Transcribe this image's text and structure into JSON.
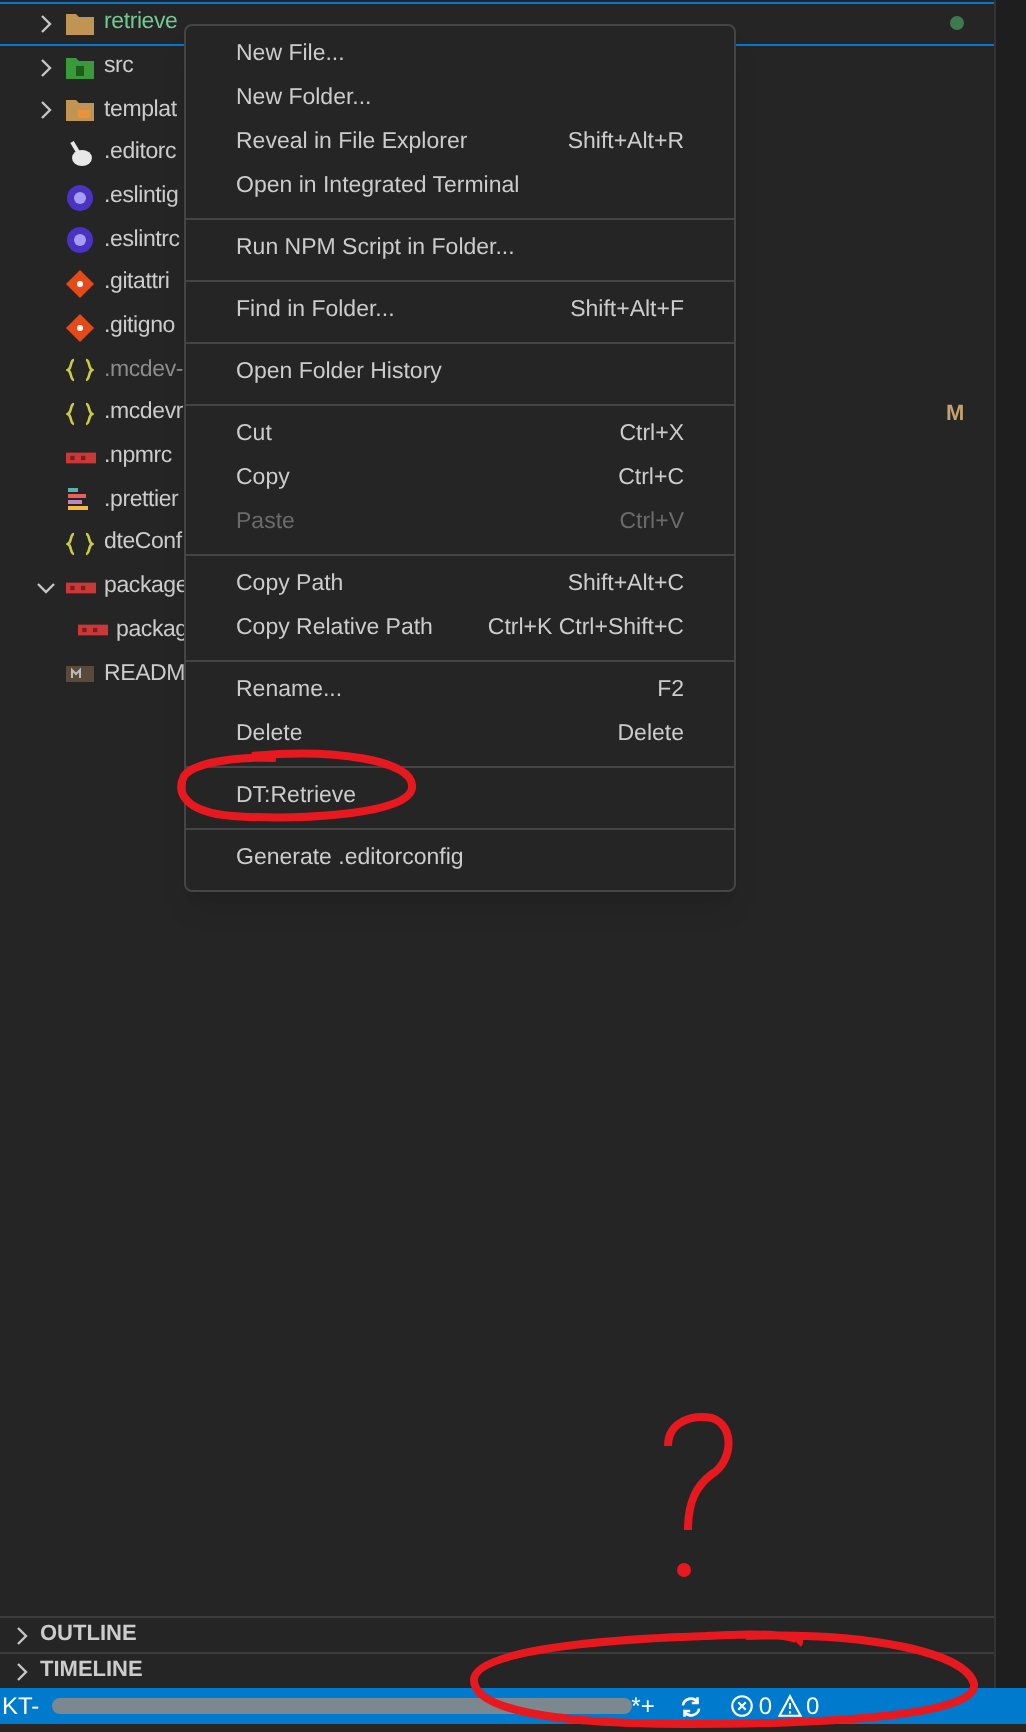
{
  "explorer": {
    "tree": [
      {
        "label": "retrieve",
        "kind": "folder",
        "expanded": false,
        "selected": true,
        "untracked": true,
        "ignored": false,
        "dot": true
      },
      {
        "label": "src",
        "kind": "src-folder",
        "expanded": false,
        "selected": false,
        "untracked": false,
        "ignored": false
      },
      {
        "label": "templat",
        "kind": "template-folder",
        "expanded": false,
        "selected": false,
        "untracked": false,
        "ignored": false
      },
      {
        "label": ".editorc",
        "kind": "editorconfig",
        "selected": false,
        "untracked": false,
        "ignored": false
      },
      {
        "label": ".eslintig",
        "kind": "eslint",
        "selected": false,
        "untracked": false,
        "ignored": false
      },
      {
        "label": ".eslintrc",
        "kind": "eslint",
        "selected": false,
        "untracked": false,
        "ignored": false
      },
      {
        "label": ".gitattri",
        "kind": "git",
        "selected": false,
        "untracked": false,
        "ignored": false
      },
      {
        "label": ".gitigno",
        "kind": "git",
        "selected": false,
        "untracked": false,
        "ignored": false
      },
      {
        "label": ".mcdev-",
        "kind": "json",
        "selected": false,
        "untracked": false,
        "ignored": true
      },
      {
        "label": ".mcdevr",
        "kind": "json",
        "selected": false,
        "untracked": false,
        "ignored": false,
        "badge": "M"
      },
      {
        "label": ".npmrc",
        "kind": "npm",
        "selected": false,
        "untracked": false,
        "ignored": false
      },
      {
        "label": ".prettier",
        "kind": "prettier",
        "selected": false,
        "untracked": false,
        "ignored": false
      },
      {
        "label": "dteConf",
        "kind": "json",
        "selected": false,
        "untracked": false,
        "ignored": false
      },
      {
        "label": "package",
        "kind": "npm",
        "expanded": true,
        "selected": false,
        "untracked": false,
        "ignored": false,
        "children": [
          {
            "label": "packag",
            "kind": "npm",
            "selected": false,
            "untracked": false,
            "ignored": false
          }
        ]
      },
      {
        "label": "READM",
        "kind": "readme",
        "selected": false,
        "untracked": false,
        "ignored": false
      }
    ]
  },
  "context_menu": {
    "groups": [
      [
        {
          "label": "New File...",
          "disabled": false
        },
        {
          "label": "New Folder...",
          "disabled": false
        },
        {
          "label": "Reveal in File Explorer",
          "shortcut": "Shift+Alt+R",
          "disabled": false
        },
        {
          "label": "Open in Integrated Terminal",
          "disabled": false
        }
      ],
      [
        {
          "label": "Run NPM Script in Folder...",
          "disabled": false
        }
      ],
      [
        {
          "label": "Find in Folder...",
          "shortcut": "Shift+Alt+F",
          "disabled": false
        }
      ],
      [
        {
          "label": "Open Folder History",
          "disabled": false
        }
      ],
      [
        {
          "label": "Cut",
          "shortcut": "Ctrl+X",
          "disabled": false
        },
        {
          "label": "Copy",
          "shortcut": "Ctrl+C",
          "disabled": false
        },
        {
          "label": "Paste",
          "shortcut": "Ctrl+V",
          "disabled": true
        }
      ],
      [
        {
          "label": "Copy Path",
          "shortcut": "Shift+Alt+C",
          "disabled": false
        },
        {
          "label": "Copy Relative Path",
          "shortcut": "Ctrl+K Ctrl+Shift+C",
          "disabled": false
        }
      ],
      [
        {
          "label": "Rename...",
          "shortcut": "F2",
          "disabled": false
        },
        {
          "label": "Delete",
          "shortcut": "Delete",
          "disabled": false
        }
      ],
      [
        {
          "label": "DT:Retrieve",
          "disabled": false
        }
      ],
      [
        {
          "label": "Generate .editorconfig",
          "disabled": false
        }
      ]
    ]
  },
  "panels": [
    {
      "title": "OUTLINE",
      "expanded": false
    },
    {
      "title": "TIMELINE",
      "expanded": false
    }
  ],
  "status_bar": {
    "branch_start": "KT-",
    "branch_end": "*+",
    "errors": "0",
    "warnings": "0"
  }
}
